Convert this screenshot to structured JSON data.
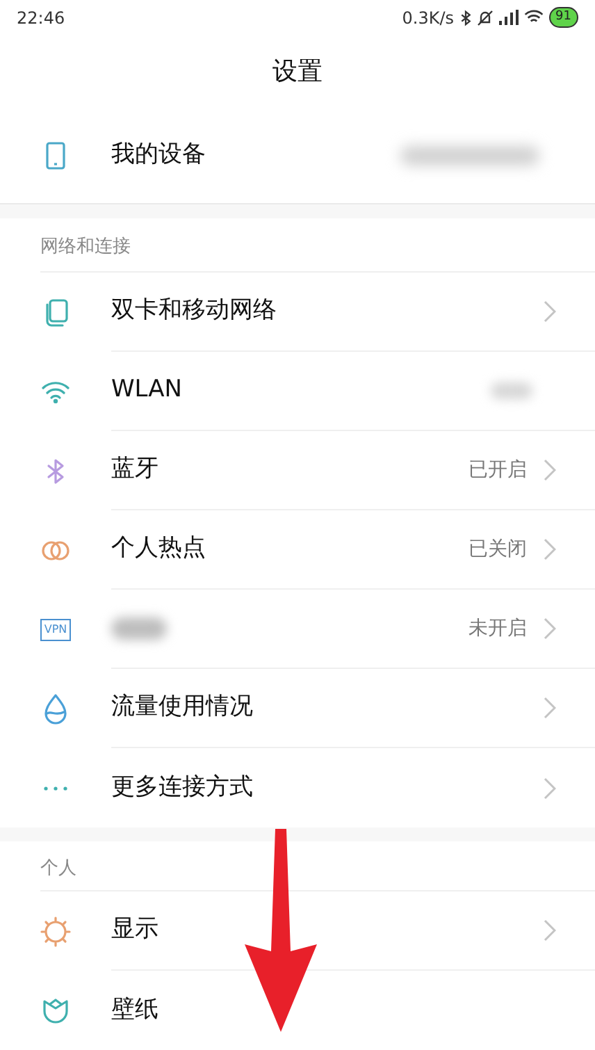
{
  "status_bar": {
    "time": "22:46",
    "speed": "0.3K/s",
    "battery": "91"
  },
  "title": "设置",
  "device": {
    "label": "我的设备",
    "value_blurred": true
  },
  "sections": [
    {
      "header": "网络和连接",
      "items": [
        {
          "kind": "sim",
          "label": "双卡和移动网络",
          "chevron": true
        },
        {
          "kind": "wifi",
          "label": "WLAN",
          "value_blurred": true,
          "chevron": false
        },
        {
          "kind": "bluetooth",
          "label": "蓝牙",
          "value": "已开启",
          "chevron": true
        },
        {
          "kind": "hotspot",
          "label": "个人热点",
          "value": "已关闭",
          "chevron": true
        },
        {
          "kind": "vpn",
          "icon_text": "VPN",
          "label_blurred": true,
          "value": "未开启",
          "chevron": true
        },
        {
          "kind": "drop",
          "label": "流量使用情况",
          "chevron": true
        },
        {
          "kind": "dots",
          "label": "更多连接方式",
          "chevron": true
        }
      ]
    },
    {
      "header": "个人",
      "items": [
        {
          "kind": "sun",
          "label": "显示",
          "chevron": true
        },
        {
          "kind": "tulip",
          "label": "壁纸",
          "chevron": false
        }
      ]
    }
  ],
  "annotation": {
    "kind": "arrow"
  }
}
